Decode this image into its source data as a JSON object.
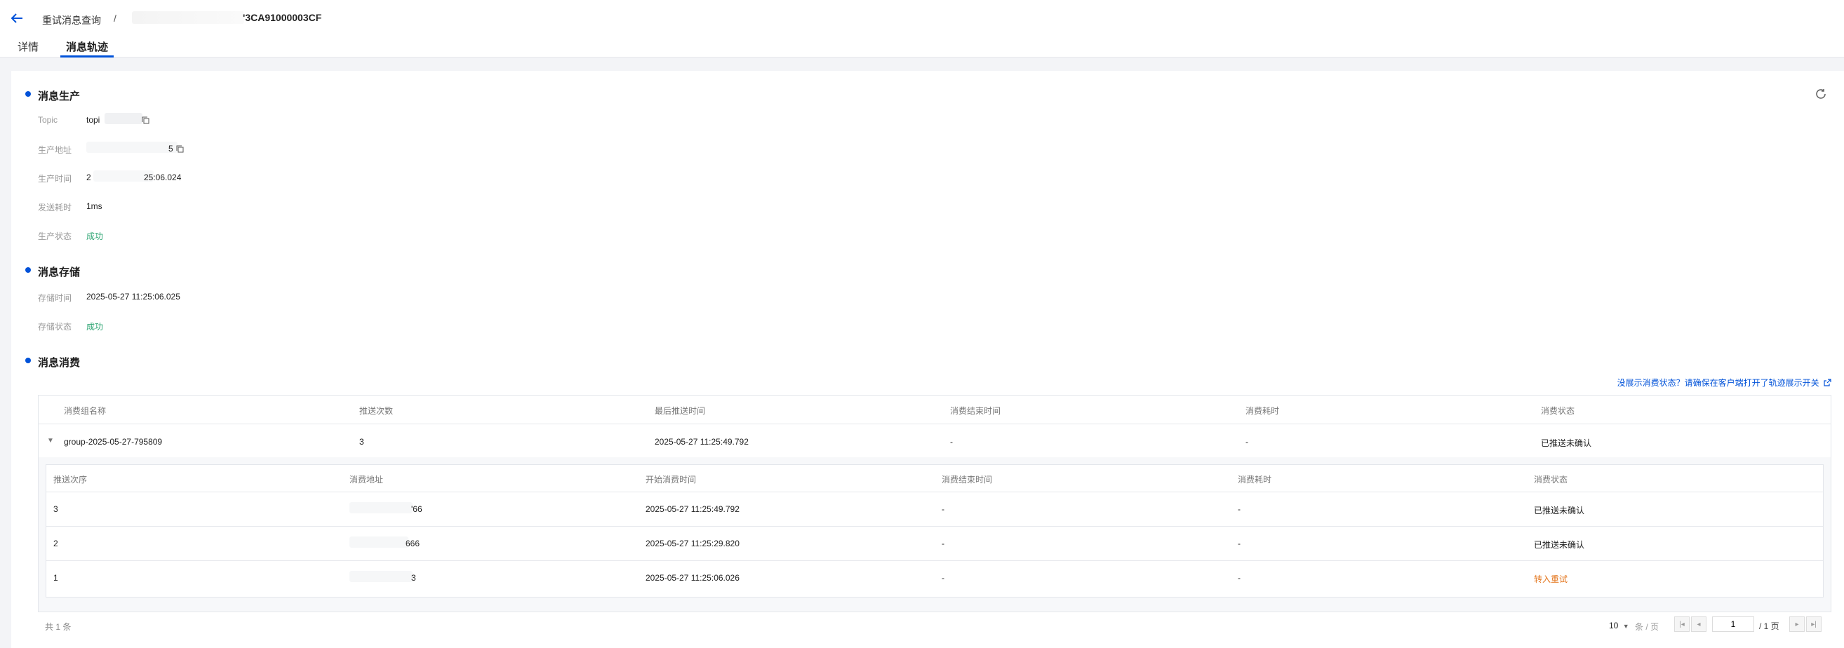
{
  "header": {
    "breadcrumb_parent": "重试消息查询",
    "separator": "/",
    "message_id_visible": "'3CA91000003CF",
    "tabs": [
      {
        "label": "详情",
        "active": false
      },
      {
        "label": "消息轨迹",
        "active": true
      }
    ]
  },
  "production": {
    "title": "消息生产",
    "fields": [
      {
        "key": "Topic",
        "value": "topi"
      },
      {
        "key": "生产地址",
        "value": "5"
      },
      {
        "key": "生产时间",
        "value": "2",
        "value2": "25:06.024"
      },
      {
        "key": "发送耗时",
        "value": "1ms"
      },
      {
        "key": "生产状态",
        "value": "成功"
      }
    ]
  },
  "storage": {
    "title": "消息存储",
    "fields": [
      {
        "key": "存储时间",
        "value": "2025-05-27 11:25:06.025"
      },
      {
        "key": "存储状态",
        "value": "成功"
      }
    ]
  },
  "consumption": {
    "title": "消息消费",
    "hint": "没展示消费状态？请确保在客户端打开了轨迹展示开关",
    "columns": [
      "消费组名称",
      "推送次数",
      "最后推送时间",
      "消费结束时间",
      "消费耗时",
      "消费状态"
    ],
    "group_row": {
      "group": "group-2025-05-27-795809",
      "push_count": "3",
      "last_push": "2025-05-27 11:25:49.792",
      "end_time": "-",
      "duration": "-",
      "status": "已推送未确认"
    },
    "inner_columns": [
      "推送次序",
      "消费地址",
      "开始消费时间",
      "消费结束时间",
      "消费耗时",
      "消费状态"
    ],
    "inner_rows": [
      {
        "seq": "3",
        "address": "'66",
        "start": "2025-05-27 11:25:49.792",
        "end": "-",
        "duration": "-",
        "status": "已推送未确认"
      },
      {
        "seq": "2",
        "address": "666",
        "start": "2025-05-27 11:25:29.820",
        "end": "-",
        "duration": "-",
        "status": "已推送未确认"
      },
      {
        "seq": "1",
        "address": "3",
        "start": "2025-05-27 11:25:06.026",
        "end": "-",
        "duration": "-",
        "status": "转入重试"
      }
    ]
  },
  "pagination": {
    "total": "共 1 条",
    "page_size": "10",
    "unit": "条 / 页",
    "current_page": "1",
    "total_pages": "/ 1 页"
  },
  "colors": {
    "accent": "#0052d9",
    "success": "#2ba471",
    "warning": "#e37318"
  }
}
